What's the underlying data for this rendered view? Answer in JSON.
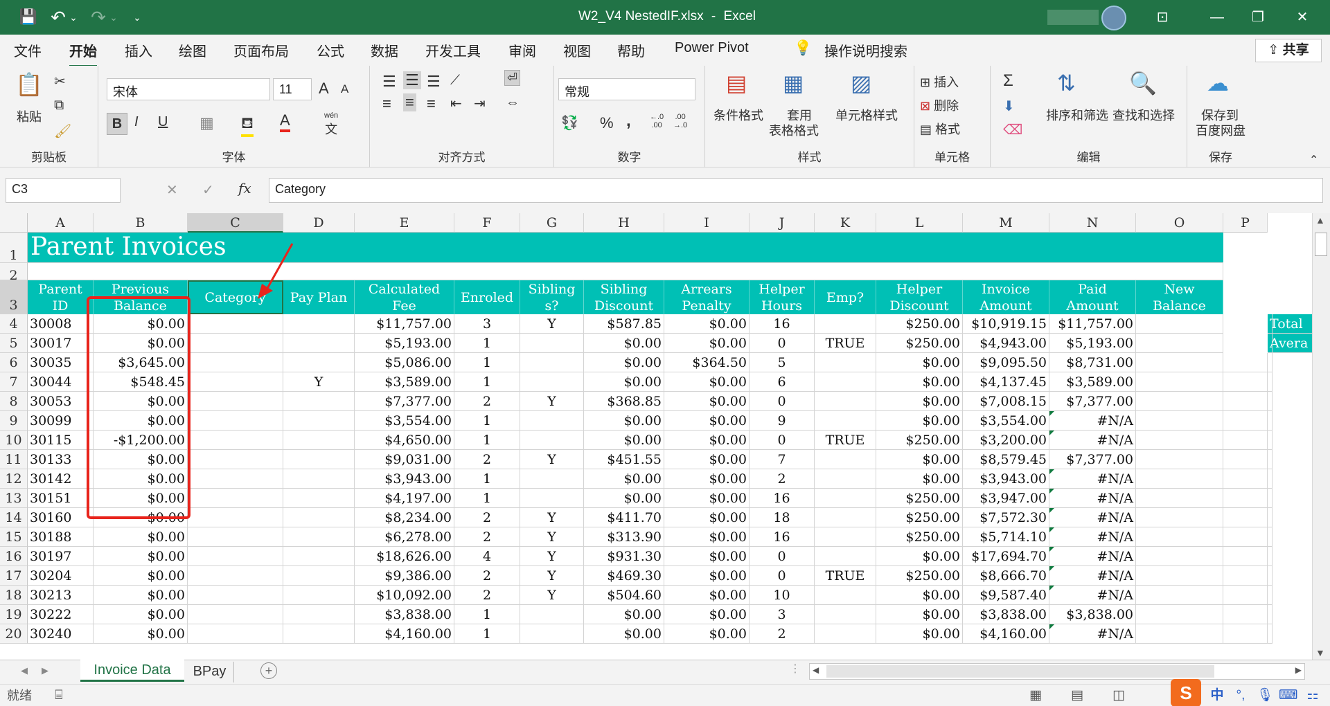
{
  "title": {
    "file": "W2_V4 NestedIF.xlsx",
    "separator": "-",
    "app": "Excel"
  },
  "qat": {
    "save": "💾",
    "undo": "↶",
    "undo_drop": "⌄",
    "redo": "↷",
    "redo_drop": "⌄",
    "customize": "⌄"
  },
  "window": {
    "ribbon_display": "⊡",
    "minimize": "—",
    "restore": "❐",
    "close": "✕"
  },
  "tabs": [
    "文件",
    "开始",
    "插入",
    "绘图",
    "页面布局",
    "公式",
    "数据",
    "开发工具",
    "审阅",
    "视图",
    "帮助",
    "Power Pivot"
  ],
  "tell_me": "操作说明搜索",
  "share": "共享",
  "ribbon": {
    "clipboard": {
      "label": "剪贴板",
      "paste": "粘贴"
    },
    "font": {
      "label": "字体",
      "name": "宋体",
      "size": "11",
      "bold": "B",
      "italic": "I",
      "underline": "U",
      "grow": "A",
      "shrink": "A",
      "color": "A",
      "wen": "wén",
      "wen_char": "文"
    },
    "alignment": {
      "label": "对齐方式"
    },
    "number": {
      "label": "数字",
      "format": "常规",
      "percent": "%",
      "comma": ",",
      "inc": "←.0\n.00",
      "dec": ".00\n→.0"
    },
    "styles": {
      "label": "样式",
      "conditional": "条件格式",
      "table_line1": "套用",
      "table_line2": "表格格式",
      "cell_styles": "单元格样式"
    },
    "cells": {
      "label": "单元格",
      "insert": "插入",
      "delete": "删除",
      "format": "格式"
    },
    "editing": {
      "label": "编辑",
      "sort": "排序和筛选",
      "find": "查找和选择",
      "sum": "Σ"
    },
    "save": {
      "label": "保存",
      "line1": "保存到",
      "line2": "百度网盘"
    }
  },
  "name_box": "C3",
  "formula_bar": {
    "fx": "fx",
    "cancel": "✕",
    "enter": "✓",
    "content": "Category"
  },
  "columns": [
    "A",
    "B",
    "C",
    "D",
    "E",
    "F",
    "G",
    "H",
    "I",
    "J",
    "K",
    "L",
    "M",
    "N",
    "O",
    "P"
  ],
  "row_numbers": [
    "1",
    "2",
    "3",
    "4",
    "5",
    "6",
    "7",
    "8",
    "9",
    "10",
    "11",
    "12",
    "13",
    "14",
    "15",
    "16",
    "17",
    "18",
    "19",
    "20"
  ],
  "sheet_title": "Parent Invoices",
  "headers": [
    "Parent ID",
    "Previous Balance",
    "Category",
    "Pay Plan",
    "Calculated Fee",
    "Enroled",
    "Sibling s?",
    "Sibling Discount",
    "Arrears Penalty",
    "Helper Hours",
    "Emp?",
    "Helper Discount",
    "Invoice Amount",
    "Paid Amount",
    "New Balance"
  ],
  "side_labels": [
    "Total",
    "Avera"
  ],
  "rows": [
    [
      "30008",
      "$0.00",
      "",
      "",
      "$11,757.00",
      "3",
      "Y",
      "$587.85",
      "$0.00",
      "16",
      "",
      "$250.00",
      "$10,919.15",
      "$11,757.00",
      ""
    ],
    [
      "30017",
      "$0.00",
      "",
      "",
      "$5,193.00",
      "1",
      "",
      "$0.00",
      "$0.00",
      "0",
      "TRUE",
      "$250.00",
      "$4,943.00",
      "$5,193.00",
      ""
    ],
    [
      "30035",
      "$3,645.00",
      "",
      "",
      "$5,086.00",
      "1",
      "",
      "$0.00",
      "$364.50",
      "5",
      "",
      "$0.00",
      "$9,095.50",
      "$8,731.00",
      ""
    ],
    [
      "30044",
      "$548.45",
      "",
      "Y",
      "$3,589.00",
      "1",
      "",
      "$0.00",
      "$0.00",
      "6",
      "",
      "$0.00",
      "$4,137.45",
      "$3,589.00",
      ""
    ],
    [
      "30053",
      "$0.00",
      "",
      "",
      "$7,377.00",
      "2",
      "Y",
      "$368.85",
      "$0.00",
      "0",
      "",
      "$0.00",
      "$7,008.15",
      "$7,377.00",
      ""
    ],
    [
      "30099",
      "$0.00",
      "",
      "",
      "$3,554.00",
      "1",
      "",
      "$0.00",
      "$0.00",
      "9",
      "",
      "$0.00",
      "$3,554.00",
      "#N/A",
      ""
    ],
    [
      "30115",
      "-$1,200.00",
      "",
      "",
      "$4,650.00",
      "1",
      "",
      "$0.00",
      "$0.00",
      "0",
      "TRUE",
      "$250.00",
      "$3,200.00",
      "#N/A",
      ""
    ],
    [
      "30133",
      "$0.00",
      "",
      "",
      "$9,031.00",
      "2",
      "Y",
      "$451.55",
      "$0.00",
      "7",
      "",
      "$0.00",
      "$8,579.45",
      "$7,377.00",
      ""
    ],
    [
      "30142",
      "$0.00",
      "",
      "",
      "$3,943.00",
      "1",
      "",
      "$0.00",
      "$0.00",
      "2",
      "",
      "$0.00",
      "$3,943.00",
      "#N/A",
      ""
    ],
    [
      "30151",
      "$0.00",
      "",
      "",
      "$4,197.00",
      "1",
      "",
      "$0.00",
      "$0.00",
      "16",
      "",
      "$250.00",
      "$3,947.00",
      "#N/A",
      ""
    ],
    [
      "30160",
      "$0.00",
      "",
      "",
      "$8,234.00",
      "2",
      "Y",
      "$411.70",
      "$0.00",
      "18",
      "",
      "$250.00",
      "$7,572.30",
      "#N/A",
      ""
    ],
    [
      "30188",
      "$0.00",
      "",
      "",
      "$6,278.00",
      "2",
      "Y",
      "$313.90",
      "$0.00",
      "16",
      "",
      "$250.00",
      "$5,714.10",
      "#N/A",
      ""
    ],
    [
      "30197",
      "$0.00",
      "",
      "",
      "$18,626.00",
      "4",
      "Y",
      "$931.30",
      "$0.00",
      "0",
      "",
      "$0.00",
      "$17,694.70",
      "#N/A",
      ""
    ],
    [
      "30204",
      "$0.00",
      "",
      "",
      "$9,386.00",
      "2",
      "Y",
      "$469.30",
      "$0.00",
      "0",
      "TRUE",
      "$250.00",
      "$8,666.70",
      "#N/A",
      ""
    ],
    [
      "30213",
      "$0.00",
      "",
      "",
      "$10,092.00",
      "2",
      "Y",
      "$504.60",
      "$0.00",
      "10",
      "",
      "$0.00",
      "$9,587.40",
      "#N/A",
      ""
    ],
    [
      "30222",
      "$0.00",
      "",
      "",
      "$3,838.00",
      "1",
      "",
      "$0.00",
      "$0.00",
      "3",
      "",
      "$0.00",
      "$3,838.00",
      "$3,838.00",
      ""
    ],
    [
      "30240",
      "$0.00",
      "",
      "",
      "$4,160.00",
      "1",
      "",
      "$0.00",
      "$0.00",
      "2",
      "",
      "$0.00",
      "$4,160.00",
      "#N/A",
      ""
    ]
  ],
  "sheets": [
    "Invoice Data",
    "BPay"
  ],
  "status": {
    "ready": "就绪",
    "ime_zh": "中",
    "ime_punct": "°,"
  },
  "colors": {
    "excel_green": "#217346",
    "header_teal": "#00c0b5",
    "annotation_red": "#e8241c"
  }
}
